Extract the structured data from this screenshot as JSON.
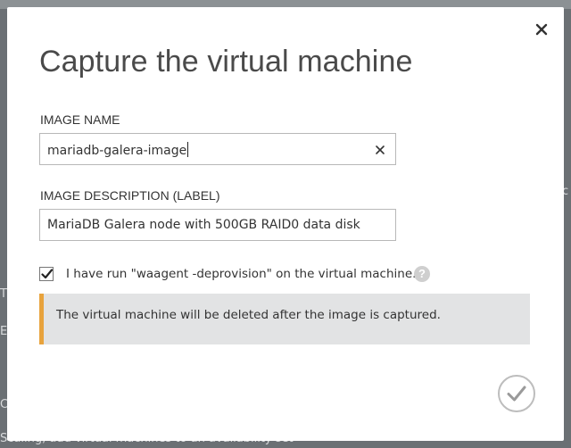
{
  "dialog": {
    "title": "Capture the virtual machine",
    "close_icon": "close-icon",
    "image_name": {
      "label": "IMAGE NAME",
      "value": "mariadb-galera-image",
      "clear_icon": "clear-icon"
    },
    "image_description": {
      "label": "IMAGE DESCRIPTION (LABEL)",
      "value": "MariaDB Galera node with 500GB RAID0 data disk"
    },
    "deprovision_checkbox": {
      "checked": true,
      "label": "I have run \"waagent -deprovision\" on the virtual machine.",
      "help_icon": "help-icon",
      "help_glyph": "?"
    },
    "warning": {
      "text": "The virtual machine will be deleted after the image is captured.",
      "accent_color": "#e8a33d"
    },
    "confirm_icon": "checkmark-icon"
  },
  "background": {
    "left_fragment_1": "T",
    "left_fragment_2": "E",
    "left_fragment_3": "C",
    "right_fragment": "c",
    "bottom_fragment": "Scaling, add virtual machines to an availability set"
  }
}
